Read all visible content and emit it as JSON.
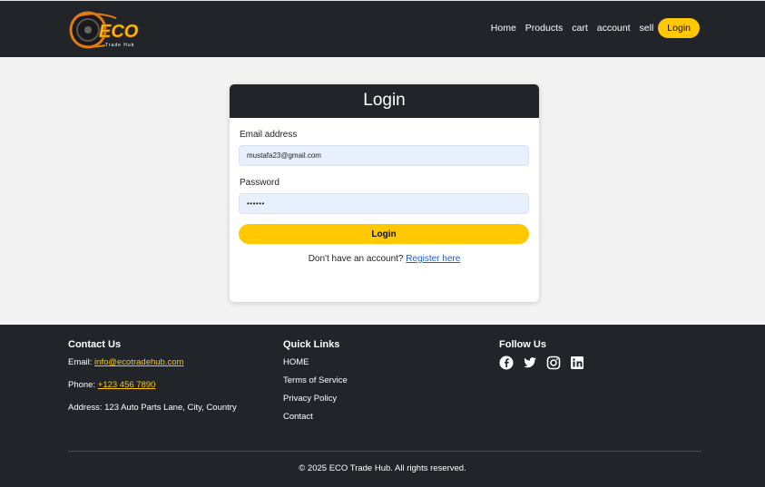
{
  "brand": {
    "logo_text": "ECO",
    "logo_subtext": "Trade Hub"
  },
  "nav": {
    "links": [
      "Home",
      "Products",
      "cart",
      "account",
      "sell"
    ],
    "login_label": "Login"
  },
  "login_card": {
    "title": "Login",
    "email_label": "Email address",
    "email_value": "mustafa23@gmail.com",
    "password_label": "Password",
    "password_value": "••••••",
    "submit_label": "Login",
    "register_prompt": "Don't have an account?",
    "register_link": "Register here"
  },
  "footer": {
    "contact": {
      "heading": "Contact Us",
      "email_label": "Email:",
      "email_value": "info@ecotradehub.com",
      "phone_label": "Phone:",
      "phone_value": "+123 456 7890",
      "address": "Address: 123 Auto Parts Lane, City, Country"
    },
    "quick_links": {
      "heading": "Quick Links",
      "items": [
        "HOME",
        "Terms of Service",
        "Privacy Policy",
        "Contact"
      ]
    },
    "follow": {
      "heading": "Follow Us",
      "icons": [
        "facebook-icon",
        "twitter-icon",
        "instagram-icon",
        "linkedin-icon"
      ]
    },
    "copyright": "© 2025 ECO Trade Hub. All rights reserved."
  },
  "colors": {
    "dark": "#212529",
    "accent": "#ffc800",
    "background": "#f3f3f3",
    "link": "#1a5fd6"
  }
}
